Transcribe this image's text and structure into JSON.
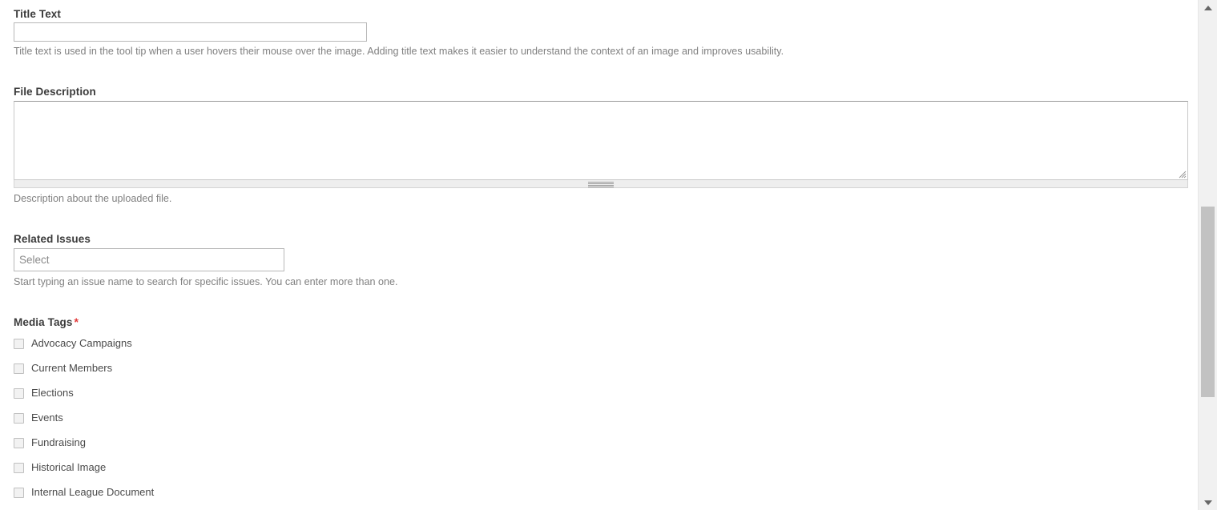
{
  "form": {
    "title_text": {
      "label": "Title Text",
      "value": "",
      "placeholder": "",
      "description": "Title text is used in the tool tip when a user hovers their mouse over the image. Adding title text makes it easier to understand the context of an image and improves usability."
    },
    "file_description": {
      "label": "File Description",
      "value": "",
      "placeholder": "",
      "description": "Description about the uploaded file."
    },
    "related_issues": {
      "label": "Related Issues",
      "value": "",
      "placeholder": "Select",
      "description": "Start typing an issue name to search for specific issues. You can enter more than one."
    },
    "media_tags": {
      "label": "Media Tags",
      "required_marker": "*",
      "options": [
        {
          "label": "Advocacy Campaigns",
          "checked": false
        },
        {
          "label": "Current Members",
          "checked": false
        },
        {
          "label": "Elections",
          "checked": false
        },
        {
          "label": "Events",
          "checked": false
        },
        {
          "label": "Fundraising",
          "checked": false
        },
        {
          "label": "Historical Image",
          "checked": false
        },
        {
          "label": "Internal League Document",
          "checked": false
        }
      ]
    }
  },
  "scrollbar": {
    "up_arrow": "scroll-up-arrow",
    "down_arrow": "scroll-down-arrow"
  },
  "colors": {
    "required_asterisk": "#e23a3a",
    "label_text": "#3b3b3b",
    "description_text": "#808080",
    "input_border": "#b8b8b8",
    "checkbox_fill": "#f2f2f2",
    "scrollbar_thumb": "#c2c2c2",
    "page_background": "#ffffff"
  }
}
